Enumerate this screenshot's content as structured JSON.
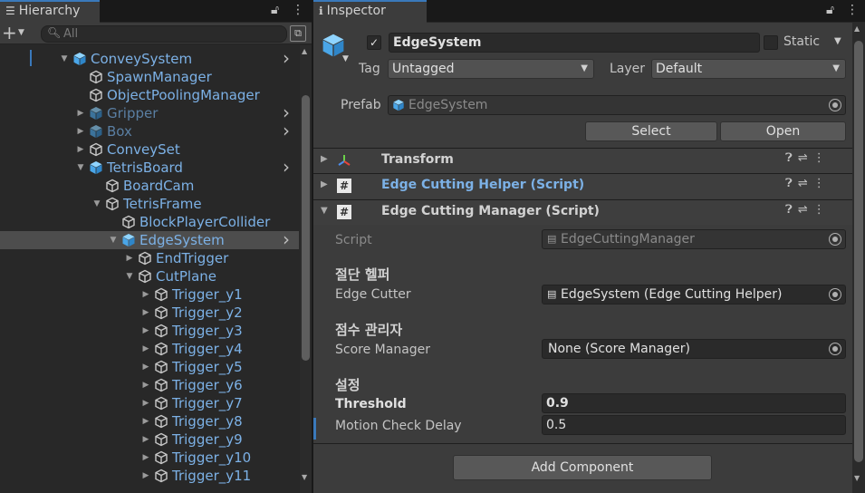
{
  "hierarchy": {
    "tab_title": "Hierarchy",
    "search_placeholder": "All",
    "rows": [
      {
        "label": "ConveySystem",
        "depth": 0,
        "arrow": "down",
        "more": true,
        "dim": false,
        "selected": false,
        "prefab": true
      },
      {
        "label": "SpawnManager",
        "depth": 1,
        "arrow": "",
        "more": false,
        "dim": false,
        "selected": false,
        "prefab": false
      },
      {
        "label": "ObjectPoolingManager",
        "depth": 1,
        "arrow": "",
        "more": false,
        "dim": false,
        "selected": false,
        "prefab": false
      },
      {
        "label": "Gripper",
        "depth": 1,
        "arrow": "right",
        "more": true,
        "dim": true,
        "selected": false,
        "prefab": true
      },
      {
        "label": "Box",
        "depth": 1,
        "arrow": "right",
        "more": true,
        "dim": true,
        "selected": false,
        "prefab": true
      },
      {
        "label": "ConveySet",
        "depth": 1,
        "arrow": "right",
        "more": false,
        "dim": false,
        "selected": false,
        "prefab": false
      },
      {
        "label": "TetrisBoard",
        "depth": 1,
        "arrow": "down",
        "more": true,
        "dim": false,
        "selected": false,
        "prefab": true
      },
      {
        "label": "BoardCam",
        "depth": 2,
        "arrow": "",
        "more": false,
        "dim": false,
        "selected": false,
        "prefab": false
      },
      {
        "label": "TetrisFrame",
        "depth": 2,
        "arrow": "down",
        "more": false,
        "dim": false,
        "selected": false,
        "prefab": false
      },
      {
        "label": "BlockPlayerCollider",
        "depth": 3,
        "arrow": "",
        "more": false,
        "dim": false,
        "selected": false,
        "prefab": false
      },
      {
        "label": "EdgeSystem",
        "depth": 3,
        "arrow": "down",
        "more": true,
        "dim": false,
        "selected": true,
        "prefab": true
      },
      {
        "label": "EndTrigger",
        "depth": 4,
        "arrow": "right",
        "more": false,
        "dim": false,
        "selected": false,
        "prefab": false
      },
      {
        "label": "CutPlane",
        "depth": 4,
        "arrow": "down",
        "more": false,
        "dim": false,
        "selected": false,
        "prefab": false
      },
      {
        "label": "Trigger_y1",
        "depth": 5,
        "arrow": "right",
        "more": false,
        "dim": false,
        "selected": false,
        "prefab": false
      },
      {
        "label": "Trigger_y2",
        "depth": 5,
        "arrow": "right",
        "more": false,
        "dim": false,
        "selected": false,
        "prefab": false
      },
      {
        "label": "Trigger_y3",
        "depth": 5,
        "arrow": "right",
        "more": false,
        "dim": false,
        "selected": false,
        "prefab": false
      },
      {
        "label": "Trigger_y4",
        "depth": 5,
        "arrow": "right",
        "more": false,
        "dim": false,
        "selected": false,
        "prefab": false
      },
      {
        "label": "Trigger_y5",
        "depth": 5,
        "arrow": "right",
        "more": false,
        "dim": false,
        "selected": false,
        "prefab": false
      },
      {
        "label": "Trigger_y6",
        "depth": 5,
        "arrow": "right",
        "more": false,
        "dim": false,
        "selected": false,
        "prefab": false
      },
      {
        "label": "Trigger_y7",
        "depth": 5,
        "arrow": "right",
        "more": false,
        "dim": false,
        "selected": false,
        "prefab": false
      },
      {
        "label": "Trigger_y8",
        "depth": 5,
        "arrow": "right",
        "more": false,
        "dim": false,
        "selected": false,
        "prefab": false
      },
      {
        "label": "Trigger_y9",
        "depth": 5,
        "arrow": "right",
        "more": false,
        "dim": false,
        "selected": false,
        "prefab": false
      },
      {
        "label": "Trigger_y10",
        "depth": 5,
        "arrow": "right",
        "more": false,
        "dim": false,
        "selected": false,
        "prefab": false
      },
      {
        "label": "Trigger_y11",
        "depth": 5,
        "arrow": "right",
        "more": false,
        "dim": false,
        "selected": false,
        "prefab": false
      }
    ]
  },
  "inspector": {
    "tab_title": "Inspector",
    "object_name": "EdgeSystem",
    "static_label": "Static",
    "tag_label": "Tag",
    "tag_value": "Untagged",
    "layer_label": "Layer",
    "layer_value": "Default",
    "prefab_label": "Prefab",
    "prefab_value": "EdgeSystem",
    "select_button": "Select",
    "open_button": "Open",
    "components": {
      "transform": "Transform",
      "helper": "Edge Cutting Helper (Script)",
      "manager": "Edge Cutting Manager (Script)"
    },
    "script_label": "Script",
    "script_value": "EdgeCuttingManager",
    "section1": "절단 헬퍼",
    "edge_cutter_label": "Edge Cutter",
    "edge_cutter_value": "EdgeSystem (Edge Cutting Helper)",
    "section2": "점수 관리자",
    "score_manager_label": "Score Manager",
    "score_manager_value": "None (Score Manager)",
    "section3": "설정",
    "threshold_label": "Threshold",
    "threshold_value": "0.9",
    "motion_label": "Motion Check Delay",
    "motion_value": "0.5",
    "add_component": "Add Component"
  },
  "colors": {
    "accent": "#3a79bb",
    "link_text": "#7cb1e6",
    "panel_bg": "#282828",
    "inspector_bg": "#3c3c3c"
  }
}
